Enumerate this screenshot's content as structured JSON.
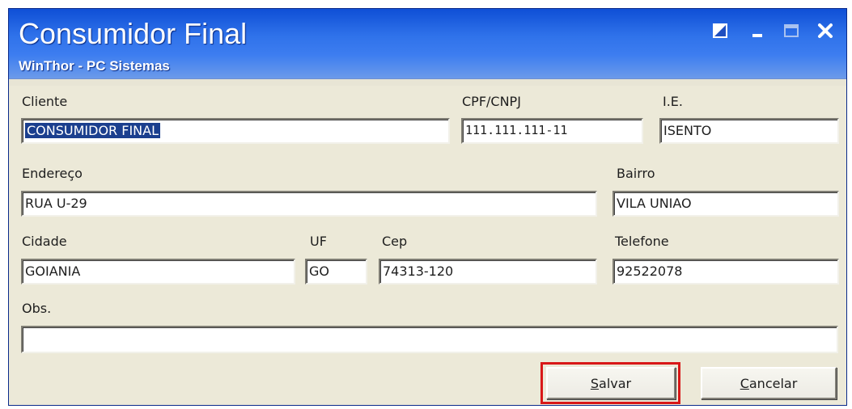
{
  "window": {
    "title": "Consumidor Final",
    "subtitle": "WinThor - PC Sistemas"
  },
  "titlebar_buttons": {
    "restore_icon": "restore-icon",
    "minimize_icon": "minimize-icon",
    "maximize_icon": "maximize-icon",
    "close_icon": "close-icon"
  },
  "form": {
    "cliente": {
      "label": "Cliente",
      "value": "CONSUMIDOR FINAL"
    },
    "cpf_cnpj": {
      "label": "CPF/CNPJ",
      "value": "111.111.111-11"
    },
    "ie": {
      "label": "I.E.",
      "value": "ISENTO"
    },
    "endereco": {
      "label": "Endereço",
      "value": "RUA U-29"
    },
    "bairro": {
      "label": "Bairro",
      "value": "VILA UNIAO"
    },
    "cidade": {
      "label": "Cidade",
      "value": "GOIANIA"
    },
    "uf": {
      "label": "UF",
      "value": "GO"
    },
    "cep": {
      "label": "Cep",
      "value": "74313-120"
    },
    "telefone": {
      "label": "Telefone",
      "value": "92522078"
    },
    "obs": {
      "label": "Obs.",
      "value": ""
    }
  },
  "buttons": {
    "salvar": {
      "accel": "S",
      "rest": "alvar"
    },
    "cancelar": {
      "accel": "C",
      "rest": "ancelar"
    }
  },
  "colors": {
    "title_bar": "#2f72ea",
    "selection": "#1b3f8e",
    "highlight": "#d81818",
    "window_bg": "#ece9d8"
  }
}
